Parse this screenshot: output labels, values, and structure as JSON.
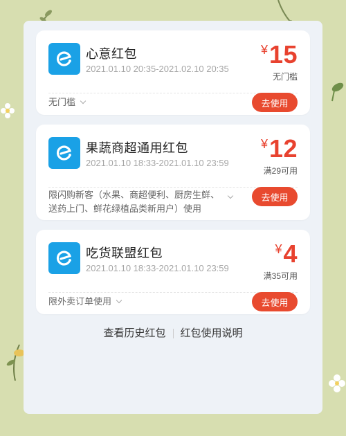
{
  "cards": [
    {
      "title": "心意红包",
      "date": "2021.01.10 20:35-2021.02.10 20:35",
      "currency": "¥",
      "amount": "15",
      "condition": "无门槛",
      "limit_lines": [
        "无门槛"
      ],
      "button": "去使用",
      "logo_icon": "eleme-logo-icon"
    },
    {
      "title": "果蔬商超通用红包",
      "date": "2021.01.10 18:33-2021.01.10 23:59",
      "currency": "¥",
      "amount": "12",
      "condition": "满29可用",
      "limit_lines": [
        "限闪购新客（水果、商超便利、厨房生鲜、",
        "送药上门、鲜花绿植品类新用户）使用"
      ],
      "button": "去使用",
      "logo_icon": "eleme-logo-icon"
    },
    {
      "title": "吃货联盟红包",
      "date": "2021.01.10 18:33-2021.01.10 23:59",
      "currency": "¥",
      "amount": "4",
      "condition": "满35可用",
      "limit_lines": [
        "限外卖订单使用"
      ],
      "button": "去使用",
      "logo_icon": "eleme-logo-icon"
    }
  ],
  "footer": {
    "history_link": "查看历史红包",
    "help_link": "红包使用说明"
  },
  "colors": {
    "accent": "#e84a2f",
    "logo_bg": "#1aa1e6",
    "page_bg": "#d7deb0"
  }
}
